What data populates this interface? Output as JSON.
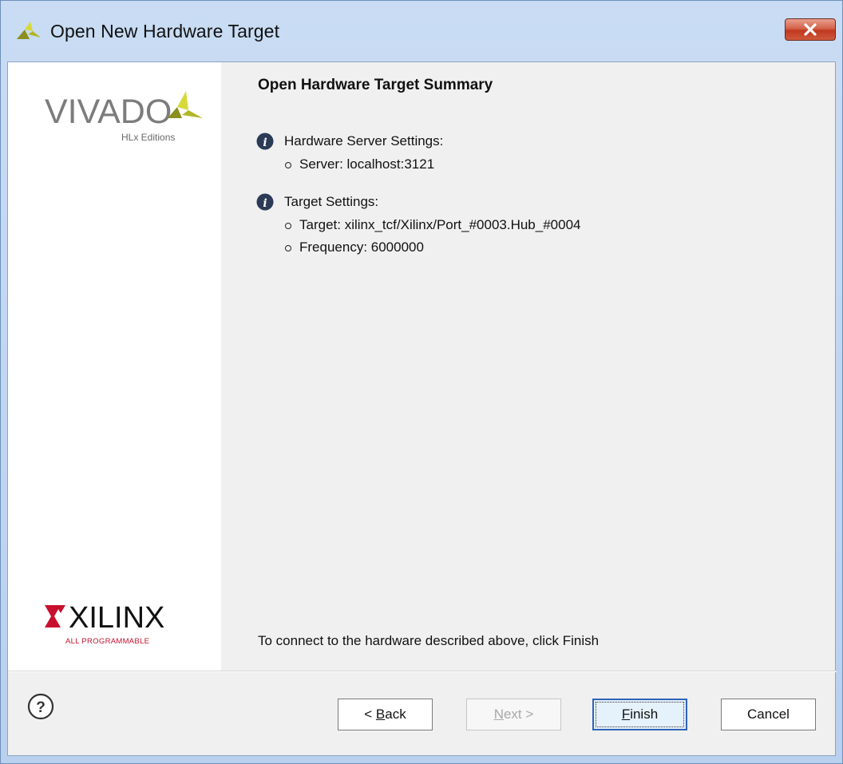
{
  "window": {
    "title": "Open New Hardware Target",
    "close_glyph": "✕"
  },
  "branding": {
    "vivado_wordmark": "VIVADO",
    "vivado_edition": "HLx Editions",
    "xilinx_wordmark": "XILINX",
    "xilinx_tagline": "ALL PROGRAMMABLE"
  },
  "summary": {
    "title": "Open Hardware Target Summary",
    "sections": [
      {
        "label": "Hardware Server Settings:",
        "items": [
          "Server: localhost:3121"
        ]
      },
      {
        "label": "Target Settings:",
        "items": [
          "Target: xilinx_tcf/Xilinx/Port_#0003.Hub_#0004",
          "Frequency: 6000000"
        ]
      }
    ],
    "footer_text": "To connect to the hardware described above, click Finish"
  },
  "buttons": {
    "back_mnemonic": "B",
    "back_prefix": "< ",
    "back_rest": "ack",
    "next_mnemonic": "N",
    "next_rest": "ext >",
    "finish_mnemonic": "F",
    "finish_rest": "inish",
    "cancel_label": "Cancel"
  },
  "icons": {
    "title": "vivado-icon",
    "info": "info-icon",
    "help": "help-icon",
    "close": "close-icon"
  },
  "colors": {
    "accent": "#2f64b8",
    "info_icon": "#2b3a55",
    "xilinx_red": "#c8102e",
    "vivado_yellow": "#c5cc2e"
  }
}
